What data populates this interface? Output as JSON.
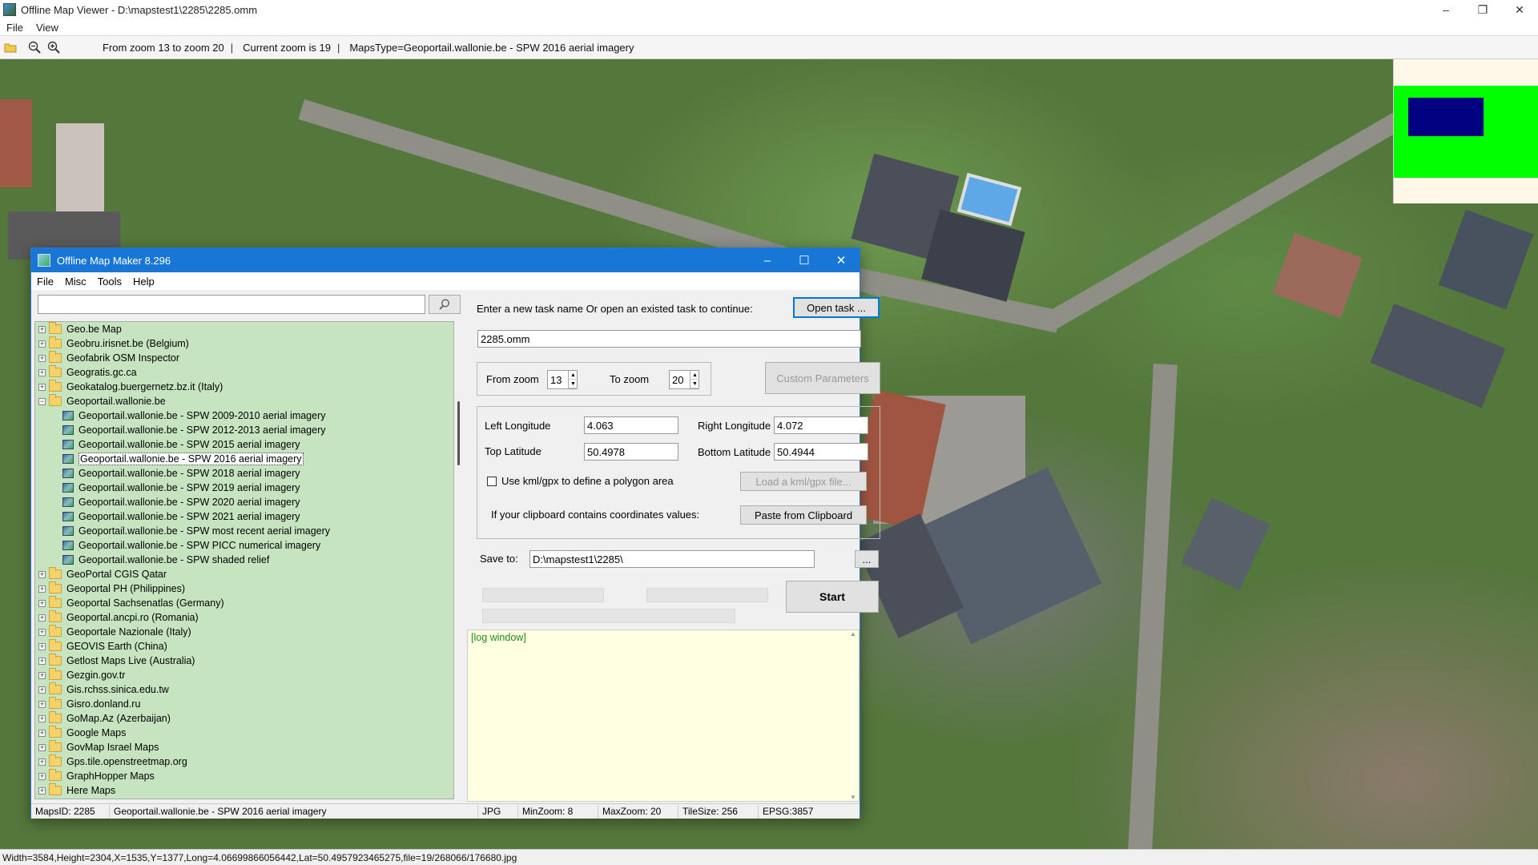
{
  "viewer": {
    "title": "Offline Map Viewer - D:\\mapstest1\\2285\\2285.omm",
    "menu": [
      "File",
      "View"
    ],
    "toolbar_info": {
      "zoom_range": "From zoom 13 to zoom 20",
      "current_zoom": "Current zoom is 19",
      "maps_type": "MapsType=Geoportail.wallonie.be - SPW 2016 aerial imagery"
    },
    "status": "Width=3584,Height=2304,X=1535,Y=1377,Long=4.06699866056442,Lat=50.4957923465275,file=19/268066/176680.jpg",
    "overview_colors": {
      "background": "#fff8e8",
      "visible_area": "#00ff00",
      "current_view": "#000080"
    }
  },
  "dialog": {
    "title": "Offline Map Maker 8.296",
    "menu": [
      "File",
      "Misc",
      "Tools",
      "Help"
    ],
    "search": {
      "value": "",
      "placeholder": ""
    },
    "tree": [
      {
        "label": "Geo.be Map",
        "type": "folder",
        "expanded": false
      },
      {
        "label": "Geobru.irisnet.be (Belgium)",
        "type": "folder",
        "expanded": false
      },
      {
        "label": "Geofabrik OSM Inspector",
        "type": "folder",
        "expanded": false
      },
      {
        "label": "Geogratis.gc.ca",
        "type": "folder",
        "expanded": false
      },
      {
        "label": "Geokatalog.buergernetz.bz.it (Italy)",
        "type": "folder",
        "expanded": false
      },
      {
        "label": "Geoportail.wallonie.be",
        "type": "folder",
        "expanded": true
      },
      {
        "label": "Geoportail.wallonie.be - SPW 2009-2010 aerial imagery",
        "type": "map"
      },
      {
        "label": "Geoportail.wallonie.be - SPW 2012-2013 aerial imagery",
        "type": "map"
      },
      {
        "label": "Geoportail.wallonie.be - SPW 2015 aerial imagery",
        "type": "map"
      },
      {
        "label": "Geoportail.wallonie.be - SPW 2016 aerial imagery",
        "type": "map",
        "selected": true
      },
      {
        "label": "Geoportail.wallonie.be - SPW 2018 aerial imagery",
        "type": "map"
      },
      {
        "label": "Geoportail.wallonie.be - SPW 2019 aerial imagery",
        "type": "map"
      },
      {
        "label": "Geoportail.wallonie.be - SPW 2020 aerial imagery",
        "type": "map"
      },
      {
        "label": "Geoportail.wallonie.be - SPW 2021 aerial imagery",
        "type": "map"
      },
      {
        "label": "Geoportail.wallonie.be - SPW most recent aerial imagery",
        "type": "map"
      },
      {
        "label": "Geoportail.wallonie.be - SPW PICC numerical imagery",
        "type": "map"
      },
      {
        "label": "Geoportail.wallonie.be - SPW shaded relief",
        "type": "map"
      },
      {
        "label": "GeoPortal CGIS Qatar",
        "type": "folder",
        "expanded": false
      },
      {
        "label": "Geoportal PH (Philippines)",
        "type": "folder",
        "expanded": false
      },
      {
        "label": "Geoportal Sachsenatlas (Germany)",
        "type": "folder",
        "expanded": false
      },
      {
        "label": "Geoportal.ancpi.ro (Romania)",
        "type": "folder",
        "expanded": false
      },
      {
        "label": "Geoportale Nazionale (Italy)",
        "type": "folder",
        "expanded": false
      },
      {
        "label": "GEOVIS Earth (China)",
        "type": "folder",
        "expanded": false
      },
      {
        "label": "Getlost Maps Live (Australia)",
        "type": "folder",
        "expanded": false
      },
      {
        "label": "Gezgin.gov.tr",
        "type": "folder",
        "expanded": false
      },
      {
        "label": "Gis.rchss.sinica.edu.tw",
        "type": "folder",
        "expanded": false
      },
      {
        "label": "Gisro.donland.ru",
        "type": "folder",
        "expanded": false
      },
      {
        "label": "GoMap.Az (Azerbaijan)",
        "type": "folder",
        "expanded": false
      },
      {
        "label": "Google Maps",
        "type": "folder",
        "expanded": false
      },
      {
        "label": "GovMap Israel Maps",
        "type": "folder",
        "expanded": false
      },
      {
        "label": "Gps.tile.openstreetmap.org",
        "type": "folder",
        "expanded": false
      },
      {
        "label": "GraphHopper Maps",
        "type": "folder",
        "expanded": false
      },
      {
        "label": "Here Maps",
        "type": "folder",
        "expanded": false
      }
    ],
    "task": {
      "prompt": "Enter a new task name Or open an existed task to continue:",
      "open_button": "Open task ...",
      "name_value": "2285.omm"
    },
    "zoom": {
      "from_label": "From zoom",
      "from_value": "13",
      "to_label": "To zoom",
      "to_value": "20",
      "custom_button": "Custom Parameters"
    },
    "coords": {
      "left_lon_label": "Left Longitude",
      "left_lon": "4.063",
      "right_lon_label": "Right Longitude",
      "right_lon": "4.072",
      "top_lat_label": "Top Latitude",
      "top_lat": "50.4978",
      "bottom_lat_label": "Bottom Latitude",
      "bottom_lat": "50.4944",
      "kml_label": "Use kml/gpx to define a polygon area",
      "kml_button": "Load a kml/gpx file...",
      "clipboard_label": "If your clipboard contains coordinates values:",
      "clipboard_button": "Paste from Clipboard"
    },
    "save": {
      "label": "Save to:",
      "path": "D:\\mapstest1\\2285\\",
      "browse": "..."
    },
    "start_button": "Start",
    "log_text": "[log window]",
    "status": {
      "maps_id": "MapsID: 2285",
      "maps_name": "Geoportail.wallonie.be - SPW 2016 aerial imagery",
      "format": "JPG",
      "min_zoom": "MinZoom: 8",
      "max_zoom": "MaxZoom: 20",
      "tile_size": "TileSize: 256",
      "epsg": "EPSG:3857"
    }
  }
}
